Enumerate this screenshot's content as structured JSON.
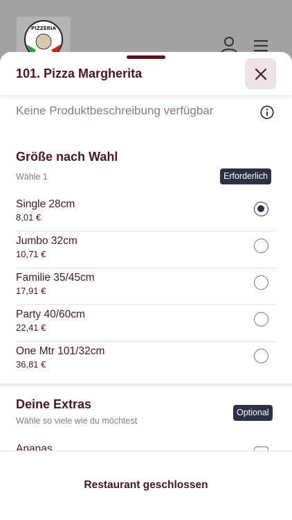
{
  "background": {
    "logo_text": "PIZZERIA"
  },
  "product": {
    "title": "101. Pizza Margherita",
    "description": "Keine Produktbeschreibung verfügbar"
  },
  "size_section": {
    "title": "Größe nach Wahl",
    "subtitle": "Wähle 1",
    "badge": "Erforderlich",
    "options": [
      {
        "name": "Single 28cm",
        "price": "8,01 €",
        "selected": true
      },
      {
        "name": "Jumbo 32cm",
        "price": "10,71 €",
        "selected": false
      },
      {
        "name": "Familie 35/45cm",
        "price": "17,91 €",
        "selected": false
      },
      {
        "name": "Party 40/60cm",
        "price": "22,41 €",
        "selected": false
      },
      {
        "name": "One Mtr 101/32cm",
        "price": "36,81 €",
        "selected": false
      }
    ]
  },
  "extras_section": {
    "title": "Deine Extras",
    "subtitle": "Wähle so viele wie du möchtest",
    "badge": "Optional",
    "items": [
      {
        "name": "Ananas"
      }
    ]
  },
  "footer": {
    "label": "Restaurant geschlossen"
  },
  "colors": {
    "primary_text": "#4a1620",
    "badge_bg": "#2b3147",
    "close_bg": "#eee4e5"
  }
}
